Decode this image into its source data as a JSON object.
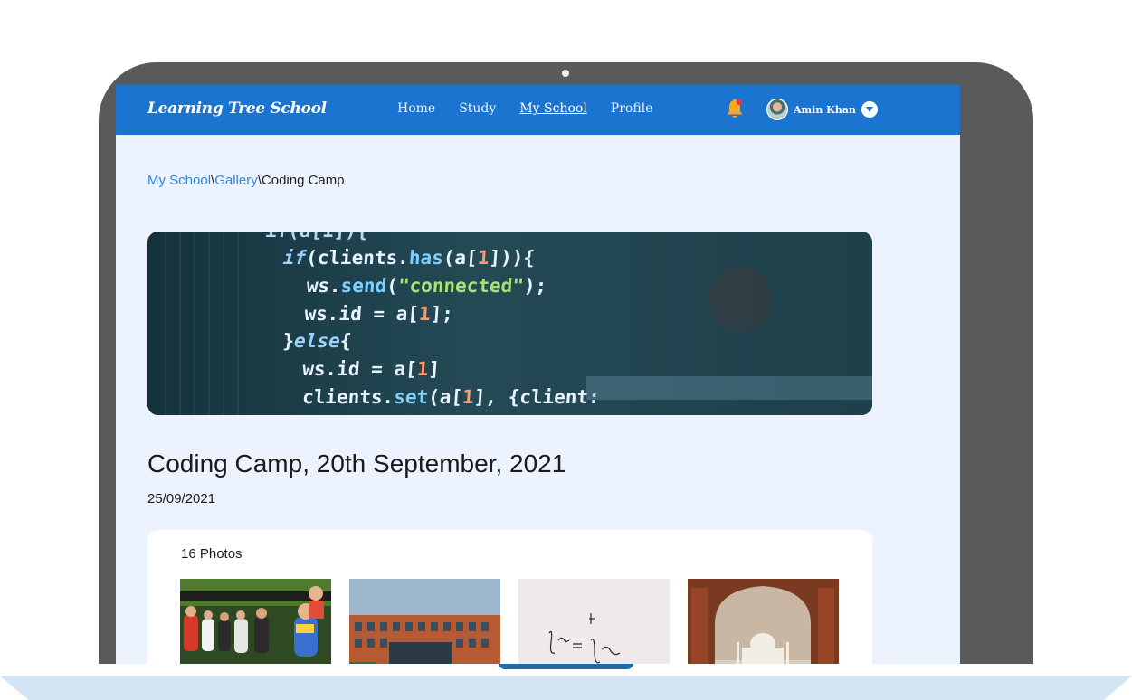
{
  "navbar": {
    "brand": "Learning Tree School",
    "links": [
      "Home",
      "Study",
      "My School",
      "Profile"
    ],
    "active_link": "My School",
    "user_name": "Amin Khan"
  },
  "breadcrumb": {
    "items": [
      "My School",
      "Gallery",
      "Coding Camp"
    ],
    "separator": "\\"
  },
  "banner": {
    "code_lines": [
      "if(clients.has(a[1])){",
      "ws.send(\"connected\");",
      "ws.id = a[1];",
      "}else{",
      "ws.id = a[1]",
      "clients.set(a[1], {client:"
    ]
  },
  "event": {
    "title": "Coding Camp, 20th September, 2021",
    "date": "25/09/2021"
  },
  "gallery": {
    "photo_count_label": "16 Photos",
    "photos": [
      {
        "name": "children-group-photo"
      },
      {
        "name": "school-building-photo"
      },
      {
        "name": "whiteboard-math-photo"
      },
      {
        "name": "taj-mahal-photo"
      }
    ]
  },
  "colors": {
    "navbar": "#1b74d0",
    "page_background": "#edf3fe",
    "link": "#2d8ae0",
    "laptop_frame": "#5a5a5a",
    "notification_dot": "#e53935",
    "bell": "#f5a623"
  }
}
